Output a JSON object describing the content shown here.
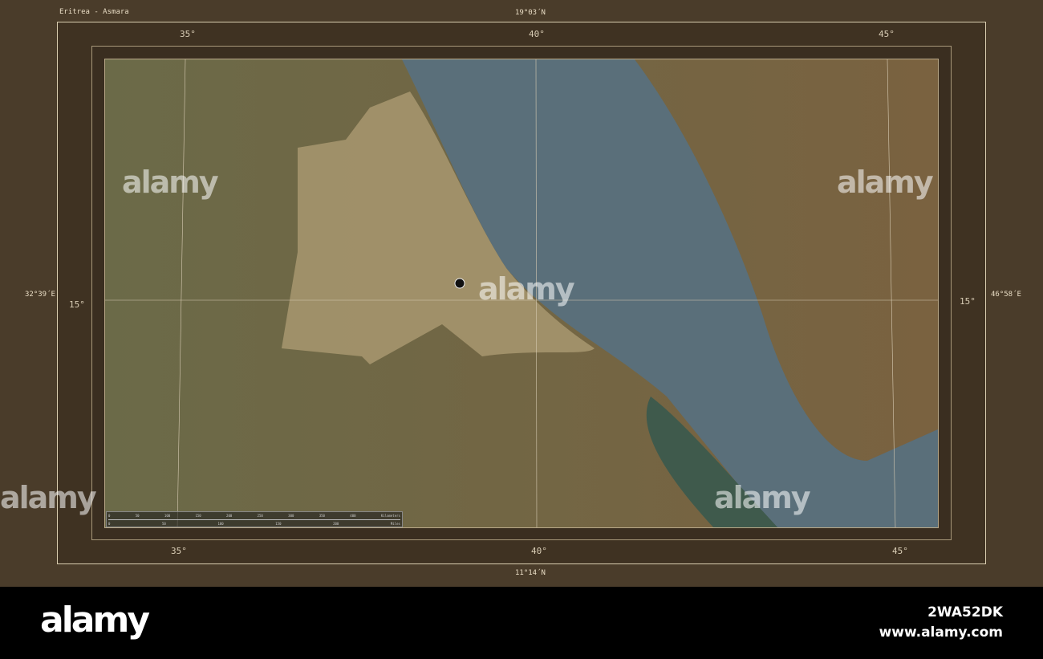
{
  "title": "Eritrea - Asmara",
  "bounds": {
    "north": "19°03´N",
    "south": "11°14´N",
    "west": "32°39´E",
    "east": "46°58´E"
  },
  "longitude_labels": [
    "35°",
    "40°",
    "45°"
  ],
  "latitude_labels": [
    "15°"
  ],
  "scale_bar": {
    "km_ticks": [
      "0",
      "50",
      "100",
      "150",
      "200",
      "250",
      "300",
      "350",
      "400"
    ],
    "km_unit": "Kilometers",
    "mi_ticks": [
      "0",
      "50",
      "100",
      "150",
      "200"
    ],
    "mi_unit": "Miles"
  },
  "capital_marker": "Asmara",
  "watermark": {
    "brand": "alamy",
    "image_id": "2WA52DK",
    "url": "www.alamy.com"
  },
  "colors": {
    "border": "#4a3c2a",
    "sea": "#5a6f7a",
    "land": "#7a6a48"
  }
}
